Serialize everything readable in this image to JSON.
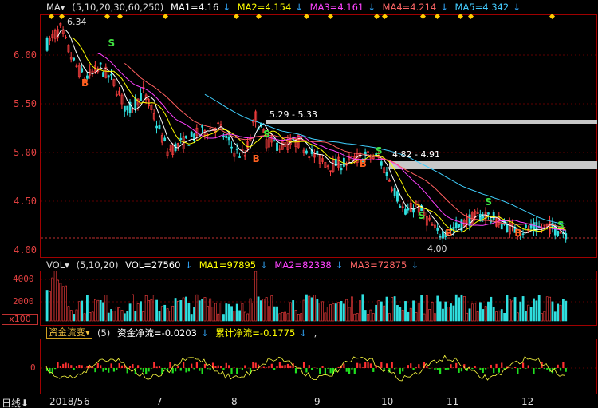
{
  "main_indicator": {
    "name": "MA",
    "params": "(5,10,20,30,60,250)",
    "ma1": "MA1=4.16",
    "ma2": "MA2=4.154",
    "ma3": "MA3=4.161",
    "ma4": "MA4=4.214",
    "ma5": "MA5=4.342",
    "colors": {
      "ma1": "#ffffff",
      "ma2": "#ffff00",
      "ma3": "#ff40ff",
      "ma4": "#ff6060",
      "ma5": "#40d0ff"
    }
  },
  "price_axis": {
    "ticks": [
      "6.00",
      "5.50",
      "5.00",
      "4.50",
      "4.00"
    ]
  },
  "price_annotations": {
    "high": "6.34",
    "low": "4.00",
    "gap1": "5.29 - 5.33",
    "gap2": "4.82 - 4.91"
  },
  "signals": {
    "buy": "B",
    "sell": "S"
  },
  "volume_indicator": {
    "name": "VOL",
    "params": "(5,10,20)",
    "vol": "VOL=27560",
    "ma1": "MA1=97895",
    "ma2": "MA2=82338",
    "ma3": "MA3=72875"
  },
  "volume_axis": {
    "ticks": [
      "4000",
      "2000"
    ],
    "unit": "x100"
  },
  "flow_indicator": {
    "name": "资金流变",
    "params": "(5)",
    "net": "资金净流=-0.0203",
    "cumulative": "累计净流=-0.1775",
    "suffix": ","
  },
  "flow_axis": {
    "zero": "0"
  },
  "time_axis": {
    "period": "日线",
    "labels": [
      "2018/5",
      "6",
      "7",
      "8",
      "9",
      "10",
      "11",
      "12"
    ]
  },
  "chart_data": {
    "type": "candlestick",
    "x": [
      "2018/5",
      "6",
      "7",
      "8",
      "9",
      "10",
      "11",
      "12"
    ],
    "ylim": [
      3.95,
      6.4
    ],
    "close_monthly_approx": [
      6.2,
      5.6,
      5.1,
      5.0,
      4.85,
      4.6,
      4.2,
      4.16
    ],
    "series": [
      {
        "name": "MA1",
        "last": 4.16
      },
      {
        "name": "MA2",
        "last": 4.154
      },
      {
        "name": "MA3",
        "last": 4.161
      },
      {
        "name": "MA4",
        "last": 4.214
      },
      {
        "name": "MA5",
        "last": 4.342
      }
    ]
  }
}
